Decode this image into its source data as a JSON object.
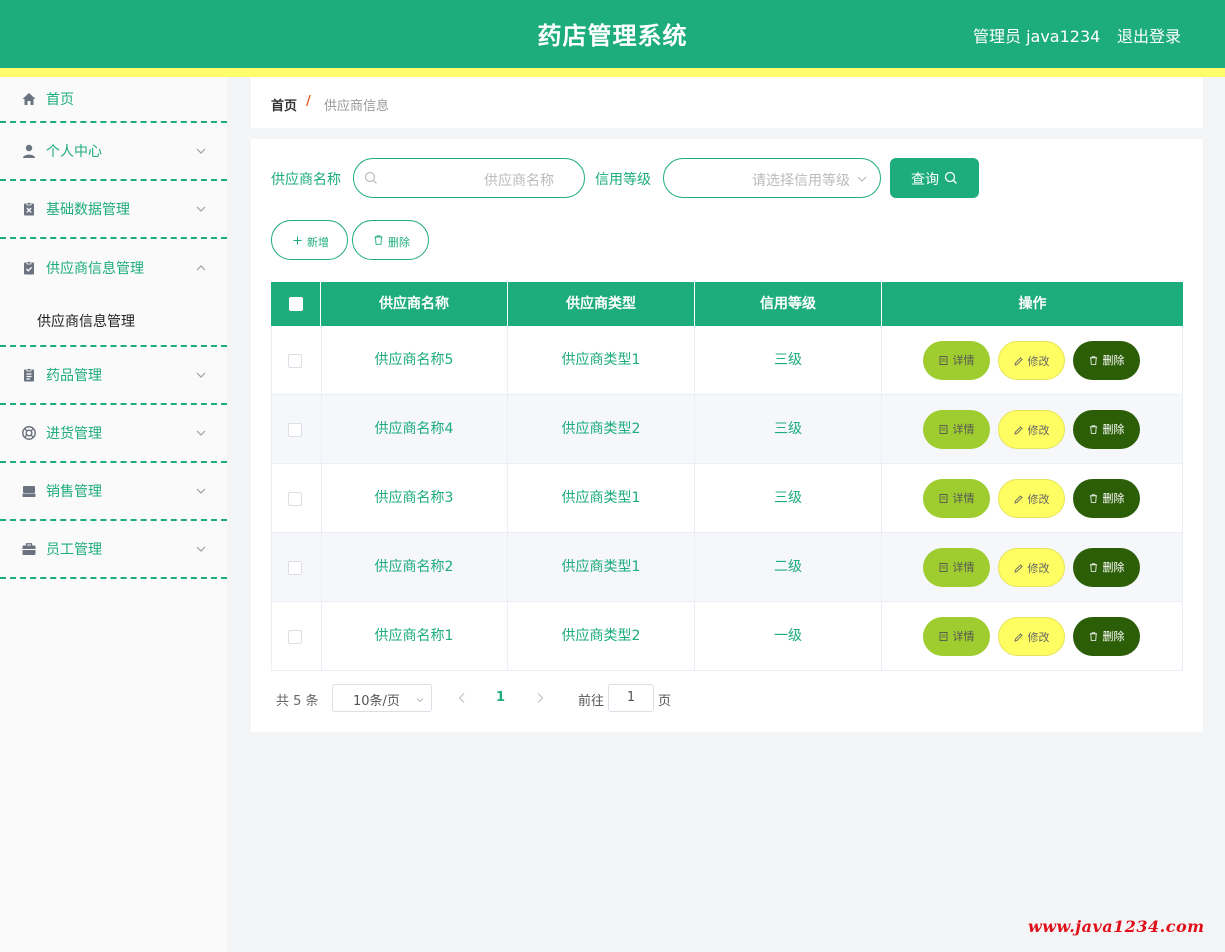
{
  "header": {
    "title": "药店管理系统",
    "user": "管理员 java1234",
    "logout": "退出登录"
  },
  "sidebar": {
    "items": [
      {
        "label": "首页",
        "icon": "home-icon"
      },
      {
        "label": "个人中心",
        "icon": "user-icon"
      },
      {
        "label": "基础数据管理",
        "icon": "clipboard-x-icon"
      },
      {
        "label": "供应商信息管理",
        "icon": "clipboard-check-icon",
        "expanded": true
      },
      {
        "label": "药品管理",
        "icon": "clipboard-list-icon"
      },
      {
        "label": "进货管理",
        "icon": "lifebuoy-icon"
      },
      {
        "label": "销售管理",
        "icon": "inbox-icon"
      },
      {
        "label": "员工管理",
        "icon": "briefcase-icon"
      }
    ],
    "submenu": {
      "label": "供应商信息管理"
    }
  },
  "breadcrumb": {
    "home": "首页",
    "separator": "/",
    "current": "供应商信息"
  },
  "search": {
    "name_label": "供应商名称",
    "name_placeholder": "供应商名称",
    "level_label": "信用等级",
    "level_placeholder": "请选择信用等级",
    "query_label": "查询"
  },
  "toolbar": {
    "add_label": "新增",
    "delete_label": "删除"
  },
  "table": {
    "columns": [
      "供应商名称",
      "供应商类型",
      "信用等级",
      "操作"
    ],
    "rows": [
      {
        "name": "供应商名称5",
        "type": "供应商类型1",
        "level": "三级"
      },
      {
        "name": "供应商名称4",
        "type": "供应商类型2",
        "level": "三级"
      },
      {
        "name": "供应商名称3",
        "type": "供应商类型1",
        "level": "三级"
      },
      {
        "name": "供应商名称2",
        "type": "供应商类型1",
        "level": "二级"
      },
      {
        "name": "供应商名称1",
        "type": "供应商类型2",
        "level": "一级"
      }
    ],
    "actions": {
      "detail": "详情",
      "edit": "修改",
      "delete": "删除"
    }
  },
  "pagination": {
    "total": "共 5 条",
    "page_size": "10条/页",
    "current_page": "1",
    "goto_label": "前往",
    "goto_value": "1",
    "page_suffix": "页"
  },
  "watermark": "www.java1234.com",
  "colors": {
    "primary": "#1dac7b",
    "stripe": "#fdfd6c",
    "detail": "#9fcd2f",
    "edit": "#fefd62",
    "delete": "#2c5e07"
  }
}
